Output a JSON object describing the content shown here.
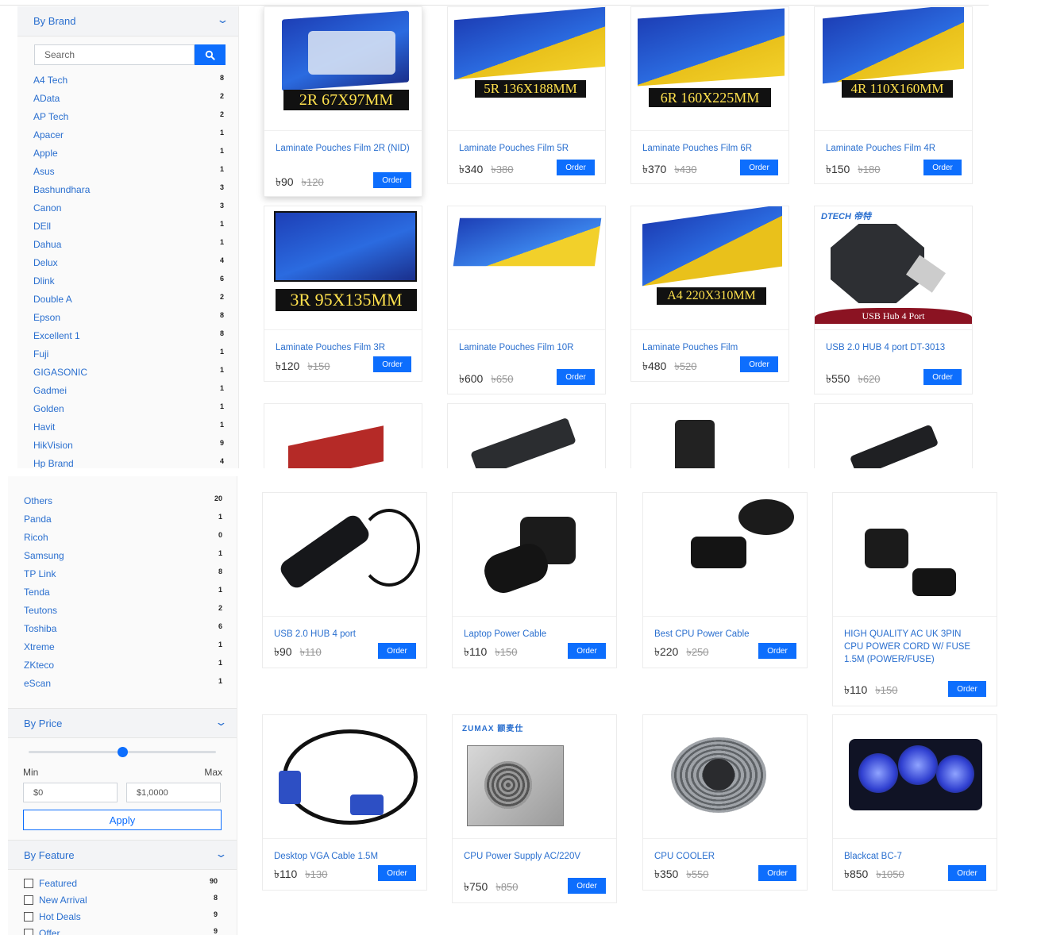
{
  "colors": {
    "accent": "#0d6efd",
    "link": "#2a6fcf"
  },
  "by_brand": {
    "title": "By Brand",
    "search_placeholder": "Search",
    "brands_top": [
      {
        "name": "A4 Tech",
        "count": "8"
      },
      {
        "name": "AData",
        "count": "2"
      },
      {
        "name": "AP Tech",
        "count": "2"
      },
      {
        "name": "Apacer",
        "count": "1"
      },
      {
        "name": "Apple",
        "count": "1"
      },
      {
        "name": "Asus",
        "count": "1"
      },
      {
        "name": "Bashundhara",
        "count": "3"
      },
      {
        "name": "Canon",
        "count": "3"
      },
      {
        "name": "DEll",
        "count": "1"
      },
      {
        "name": "Dahua",
        "count": "1"
      },
      {
        "name": "Delux",
        "count": "4"
      },
      {
        "name": "Dlink",
        "count": "6"
      },
      {
        "name": "Double A",
        "count": "2"
      },
      {
        "name": "Epson",
        "count": "8"
      },
      {
        "name": "Excellent 1",
        "count": "8"
      },
      {
        "name": "Fuji",
        "count": "1"
      },
      {
        "name": "GIGASONIC",
        "count": "1"
      },
      {
        "name": "Gadmei",
        "count": "1"
      },
      {
        "name": "Golden",
        "count": "1"
      },
      {
        "name": "Havit",
        "count": "1"
      },
      {
        "name": "HikVision",
        "count": "9"
      },
      {
        "name": "Hp Brand",
        "count": "4"
      }
    ],
    "brands_bottom": [
      {
        "name": "Others",
        "count": "20"
      },
      {
        "name": "Panda",
        "count": "1"
      },
      {
        "name": "Ricoh",
        "count": "0"
      },
      {
        "name": "Samsung",
        "count": "1"
      },
      {
        "name": "TP Link",
        "count": "8"
      },
      {
        "name": "Tenda",
        "count": "1"
      },
      {
        "name": "Teutons",
        "count": "2"
      },
      {
        "name": "Toshiba",
        "count": "6"
      },
      {
        "name": "Xtreme",
        "count": "1"
      },
      {
        "name": "ZKteco",
        "count": "1"
      },
      {
        "name": "eScan",
        "count": "1"
      }
    ]
  },
  "by_price": {
    "title": "By Price",
    "min_label": "Min",
    "max_label": "Max",
    "min_value": "$0",
    "max_value": "$1,0000",
    "apply": "Apply",
    "slider_fraction": 0.5
  },
  "by_feature": {
    "title": "By Feature",
    "items": [
      {
        "name": "Featured",
        "count": "90"
      },
      {
        "name": "New Arrival",
        "count": "8"
      },
      {
        "name": "Hot Deals",
        "count": "9"
      },
      {
        "name": "Offer",
        "count": "9"
      }
    ]
  },
  "order_label": "Order",
  "products_top": [
    {
      "name": "Laminate Pouches Film 2R (NID)",
      "price": "৳90",
      "old": "৳120",
      "caption": "2R 67X97MM"
    },
    {
      "name": "Laminate Pouches Film 5R",
      "price": "৳340",
      "old": "৳380",
      "caption": "5R 136X188MM"
    },
    {
      "name": "Laminate Pouches Film 6R",
      "price": "৳370",
      "old": "৳430",
      "caption": "6R 160X225MM"
    },
    {
      "name": "Laminate Pouches Film 4R",
      "price": "৳150",
      "old": "৳180",
      "caption": "4R 110X160MM"
    },
    {
      "name": "Laminate Pouches Film 3R",
      "price": "৳120",
      "old": "৳150",
      "caption": "3R 95X135MM"
    },
    {
      "name": "Laminate Pouches Film 10R",
      "price": "৳600",
      "old": "৳650",
      "caption": ""
    },
    {
      "name": "Laminate Pouches Film",
      "price": "৳480",
      "old": "৳520",
      "caption": "A4 220X310MM"
    },
    {
      "name": "USB 2.0 HUB 4 port DT-3013",
      "price": "৳550",
      "old": "৳620",
      "caption": "USB Hub 4 Port",
      "brand": "DTECH 帝特"
    }
  ],
  "products_bottom": [
    {
      "name": "USB 2.0 HUB 4 port",
      "price": "৳90",
      "old": "৳110"
    },
    {
      "name": "Laptop Power Cable",
      "price": "৳110",
      "old": "৳150"
    },
    {
      "name": "Best CPU Power Cable",
      "price": "৳220",
      "old": "৳250"
    },
    {
      "name": "HIGH QUALITY AC UK 3PIN CPU POWER CORD W/ FUSE 1.5M (POWER/FUSE)",
      "price": "৳110",
      "old": "৳150"
    },
    {
      "name": "Desktop VGA Cable 1.5M",
      "price": "৳110",
      "old": "৳130"
    },
    {
      "name": "CPU Power Supply AC/220V",
      "price": "৳750",
      "old": "৳850",
      "brand": "ZUMAX 颛麦仕"
    },
    {
      "name": "CPU COOLER",
      "price": "৳350",
      "old": "৳550"
    },
    {
      "name": "Blackcat BC-7",
      "price": "৳850",
      "old": "৳1050"
    }
  ]
}
